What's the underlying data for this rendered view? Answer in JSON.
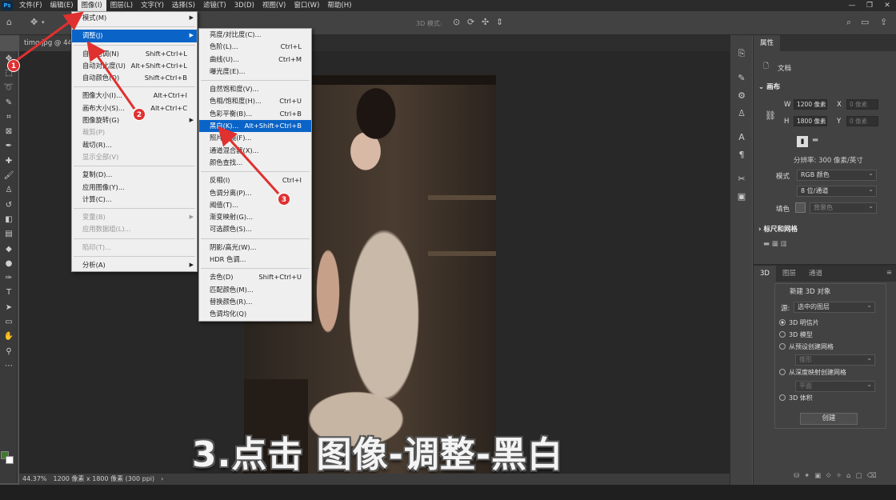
{
  "menubar": {
    "items": [
      "文件(F)",
      "编辑(E)",
      "图像(I)",
      "图层(L)",
      "文字(Y)",
      "选择(S)",
      "滤镜(T)",
      "3D(D)",
      "视图(V)",
      "窗口(W)",
      "帮助(H)"
    ],
    "active_index": 2
  },
  "document": {
    "tab_title": "timg.jpg @ 44",
    "zoom": "44.37%",
    "size_info": "1200 像素 x 1800 像素 (300 ppi)"
  },
  "caption": "3.点击 图像-调整-黑白",
  "image_menu": [
    {
      "label": "模式(M)",
      "submenu": true
    },
    {
      "sep": true
    },
    {
      "label": "调整(J)",
      "submenu": true,
      "highlight": true
    },
    {
      "sep": true
    },
    {
      "label": "自动色调(N)",
      "shortcut": "Shift+Ctrl+L"
    },
    {
      "label": "自动对比度(U)",
      "shortcut": "Alt+Shift+Ctrl+L"
    },
    {
      "label": "自动颜色(O)",
      "shortcut": "Shift+Ctrl+B"
    },
    {
      "sep": true
    },
    {
      "label": "图像大小(I)...",
      "shortcut": "Alt+Ctrl+I"
    },
    {
      "label": "画布大小(S)...",
      "shortcut": "Alt+Ctrl+C"
    },
    {
      "label": "图像旋转(G)",
      "submenu": true
    },
    {
      "label": "裁剪(P)",
      "disabled": true
    },
    {
      "label": "裁切(R)..."
    },
    {
      "label": "显示全部(V)",
      "disabled": true
    },
    {
      "sep": true
    },
    {
      "label": "复制(D)..."
    },
    {
      "label": "应用图像(Y)..."
    },
    {
      "label": "计算(C)..."
    },
    {
      "sep": true
    },
    {
      "label": "变量(B)",
      "submenu": true,
      "disabled": true
    },
    {
      "label": "应用数据组(L)...",
      "disabled": true
    },
    {
      "sep": true
    },
    {
      "label": "陷印(T)...",
      "disabled": true
    },
    {
      "sep": true
    },
    {
      "label": "分析(A)",
      "submenu": true
    }
  ],
  "adjust_menu": [
    {
      "label": "亮度/对比度(C)..."
    },
    {
      "label": "色阶(L)...",
      "shortcut": "Ctrl+L"
    },
    {
      "label": "曲线(U)...",
      "shortcut": "Ctrl+M"
    },
    {
      "label": "曝光度(E)..."
    },
    {
      "sep": true
    },
    {
      "label": "自然饱和度(V)..."
    },
    {
      "label": "色相/饱和度(H)...",
      "shortcut": "Ctrl+U"
    },
    {
      "label": "色彩平衡(B)...",
      "shortcut": "Ctrl+B"
    },
    {
      "label": "黑白(K)...",
      "shortcut": "Alt+Shift+Ctrl+B",
      "highlight": true
    },
    {
      "label": "照片滤镜(F)..."
    },
    {
      "label": "通道混合器(X)..."
    },
    {
      "label": "颜色查找..."
    },
    {
      "sep": true
    },
    {
      "label": "反相(I)",
      "shortcut": "Ctrl+I"
    },
    {
      "label": "色调分离(P)..."
    },
    {
      "label": "阈值(T)..."
    },
    {
      "label": "渐变映射(G)..."
    },
    {
      "label": "可选颜色(S)..."
    },
    {
      "sep": true
    },
    {
      "label": "阴影/高光(W)..."
    },
    {
      "label": "HDR 色调..."
    },
    {
      "sep": true
    },
    {
      "label": "去色(D)",
      "shortcut": "Shift+Ctrl+U"
    },
    {
      "label": "匹配颜色(M)..."
    },
    {
      "label": "替换颜色(R)..."
    },
    {
      "label": "色调均化(Q)"
    }
  ],
  "markers": [
    "1",
    "2",
    "3"
  ],
  "properties": {
    "tab": "属性",
    "doc_label": "文档",
    "canvas_section": "画布",
    "w_label": "W",
    "w_value": "1200 像素",
    "h_label": "H",
    "h_value": "1800 像素",
    "x_label": "X",
    "x_value": "0 像素",
    "y_label": "Y",
    "y_value": "0 像素",
    "resolution": "分辨率: 300 像素/英寸",
    "mode_label": "模式",
    "mode_value": "RGB 颜色",
    "depth_value": "8 位/通道",
    "fill_label": "填色",
    "fill_value": "背景色",
    "rulers_section": "标尺和网格"
  },
  "panel3d": {
    "tabs": [
      "3D",
      "图层",
      "通道"
    ],
    "title": "新建 3D 对象",
    "source_label": "源:",
    "source_value": "选中的图层",
    "options": [
      "3D 明信片",
      "3D 模型",
      "从预设创建网格",
      "从深度映射创建网格",
      "3D 体积"
    ],
    "preset_value": "锥形",
    "depth_value": "平面",
    "create_button": "创建"
  },
  "optbar": {
    "mode_3d": "3D 模式:"
  },
  "colors": {
    "highlight": "#0a64c8",
    "marker": "#e03030",
    "foreground": "#3f7a2e"
  }
}
